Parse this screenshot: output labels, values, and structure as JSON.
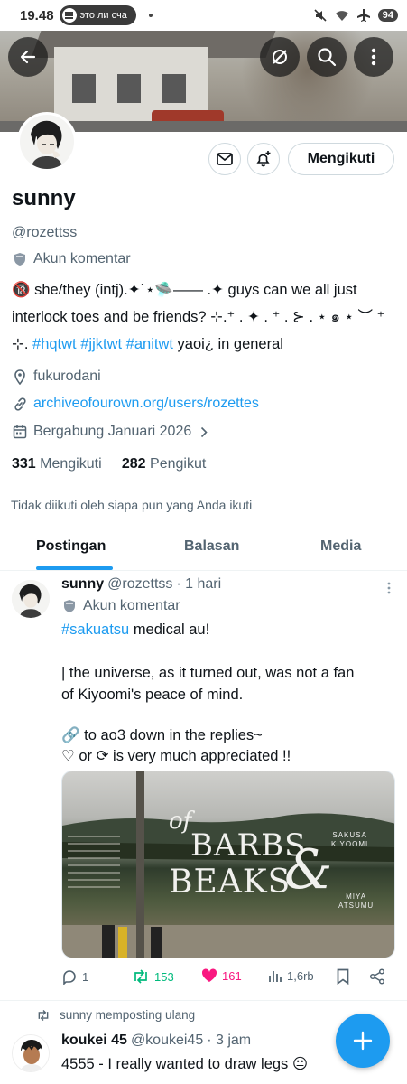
{
  "status_bar": {
    "time": "19.48",
    "now_playing": "это ли сча",
    "battery": "94"
  },
  "profile": {
    "display_name": "sunny",
    "handle": "@rozettss",
    "account_label": "Akun komentar",
    "bio_line1": "🔞 she/they (intj).✦˙⋆🛸—— .✦ guys can we all just",
    "bio_line2": "interlock toes and be friends? ⊹.⁺ . ✦ . ⁺ . ⊱ . ⋆ ๑ ⋆ ︶ ⁺",
    "bio_line3_prefix": "⊹.",
    "bio_hashtags": [
      "#hqtwt",
      "#jjktwt",
      "#anitwt"
    ],
    "bio_line3_suffix": "yaoi¿ in general",
    "location": "fukurodani",
    "website": "archiveofourown.org/users/rozettes",
    "joined": "Bergabung Januari 2026",
    "following_count": "331",
    "following_label": "Mengikuti",
    "followers_count": "282",
    "followers_label": "Pengikut",
    "not_followed_note": "Tidak diikuti oleh siapa pun yang Anda ikuti",
    "follow_button": "Mengikuti"
  },
  "tabs": [
    {
      "label": "Postingan",
      "active": true
    },
    {
      "label": "Balasan",
      "active": false
    },
    {
      "label": "Media",
      "active": false
    }
  ],
  "tweet": {
    "name": "sunny",
    "handle": "@rozettss",
    "time": "· 1 hari",
    "account_label": "Akun komentar",
    "hashtag": "#sakuatsu",
    "line1_suffix": "medical au!",
    "line2": "| the universe, as it turned out, was not a fan",
    "line3": "of Kiyoomi's peace of mind.",
    "line4": "🔗 to ao3 down in the replies~",
    "line5": "♡ or ⟳ is very much appreciated !!",
    "media": {
      "title_top": "of",
      "title_main": "BARBS",
      "title_amp": "&",
      "title_bottom": "BEAKS",
      "name_a": "SAKUSA\nKIYOOMI",
      "name_b": "MIYA\nATSUMU"
    },
    "replies": "1",
    "retweets": "153",
    "likes": "161",
    "views": "1,6rb"
  },
  "repost": {
    "label": "sunny memposting ulang"
  },
  "tweet2": {
    "name": "koukei 45",
    "handle": "@koukei45",
    "time": "· 3 jam",
    "text": "4555 - I really wanted to draw legs 😐"
  },
  "colors": {
    "accent": "#1d9bf0",
    "text": "#0f1419",
    "muted": "#536471",
    "retweet": "#00ba7c",
    "like": "#f91880"
  }
}
